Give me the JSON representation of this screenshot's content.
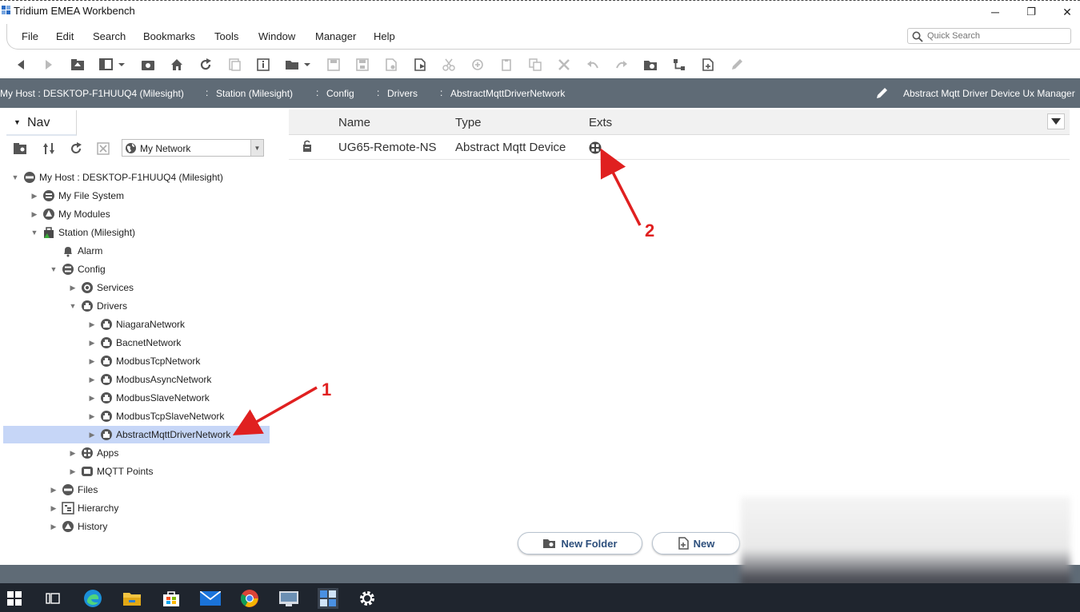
{
  "window": {
    "title": "Tridium EMEA Workbench",
    "minimize": "─",
    "restore": "❐",
    "close": "✕"
  },
  "menu": [
    "File",
    "Edit",
    "Search",
    "Bookmarks",
    "Tools",
    "Window",
    "Manager",
    "Help"
  ],
  "quick_search": {
    "placeholder": "Quick Search"
  },
  "toolbar": {
    "icons": [
      "back-icon",
      "forward-icon",
      "up-level-icon",
      "side-bar-icon",
      "refresh-icon",
      "home-icon",
      "reload-icon",
      "history-icon",
      "properties-icon",
      "open-icon",
      "save-icon",
      "save-all-icon",
      "save-bog-icon",
      "export-icon",
      "cut-icon",
      "copy-icon",
      "paste-icon",
      "duplicate-icon",
      "delete-icon",
      "undo-icon",
      "redo-icon",
      "new-folder-icon",
      "link-icon",
      "new-file-icon",
      "edit-icon"
    ]
  },
  "path": {
    "host": "My Host : DESKTOP-F1HUUQ4 (Milesight)",
    "station": "Station (Milesight)",
    "config": "Config",
    "drivers": "Drivers",
    "network": "AbstractMqttDriverNetwork",
    "separator": ":",
    "view": "Abstract Mqtt Driver Device Ux Manager"
  },
  "nav": {
    "tab_label": "Nav",
    "select_value": "My Network",
    "tree": [
      {
        "label": "My Host : DESKTOP-F1HUUQ4 (Milesight)",
        "icon": "host-icon",
        "state": "expanded"
      },
      {
        "label": "My File System",
        "icon": "file-system-icon",
        "state": "collapsed"
      },
      {
        "label": "My Modules",
        "icon": "modules-icon",
        "state": "collapsed"
      },
      {
        "label": "Station (Milesight)",
        "icon": "station-icon",
        "state": "expanded"
      },
      {
        "label": "Alarm",
        "icon": "alarm-icon",
        "state": "none"
      },
      {
        "label": "Config",
        "icon": "config-icon",
        "state": "expanded"
      },
      {
        "label": "Services",
        "icon": "services-icon",
        "state": "collapsed"
      },
      {
        "label": "Drivers",
        "icon": "drivers-icon",
        "state": "expanded"
      },
      {
        "label": "NiagaraNetwork",
        "icon": "network-icon",
        "state": "collapsed"
      },
      {
        "label": "BacnetNetwork",
        "icon": "network-icon",
        "state": "collapsed"
      },
      {
        "label": "ModbusTcpNetwork",
        "icon": "network-icon",
        "state": "collapsed"
      },
      {
        "label": "ModbusAsyncNetwork",
        "icon": "network-icon",
        "state": "collapsed"
      },
      {
        "label": "ModbusSlaveNetwork",
        "icon": "network-icon",
        "state": "collapsed"
      },
      {
        "label": "ModbusTcpSlaveNetwork",
        "icon": "network-icon",
        "state": "collapsed"
      },
      {
        "label": "AbstractMqttDriverNetwork",
        "icon": "network-icon",
        "state": "collapsed",
        "selected": true
      },
      {
        "label": "Apps",
        "icon": "apps-icon",
        "state": "collapsed"
      },
      {
        "label": "MQTT Points",
        "icon": "points-icon",
        "state": "collapsed"
      },
      {
        "label": "Files",
        "icon": "files-icon",
        "state": "collapsed"
      },
      {
        "label": "Hierarchy",
        "icon": "hierarchy-icon",
        "state": "collapsed"
      },
      {
        "label": "History",
        "icon": "history-icon",
        "state": "collapsed"
      }
    ]
  },
  "table": {
    "columns": [
      "Name",
      "Type",
      "Exts"
    ],
    "rows": [
      {
        "name": "UG65-Remote-NS",
        "type": "Abstract Mqtt Device",
        "exts_icon": "extensions-icon"
      }
    ]
  },
  "buttons": {
    "new_folder": "New Folder",
    "new": "New"
  },
  "annotations": {
    "arrow_1": "1",
    "arrow_2": "2",
    "color": "#e02020"
  },
  "taskbar": {
    "icons": [
      "windows-start-icon",
      "task-view-icon",
      "edge-icon",
      "file-explorer-icon",
      "store-icon",
      "mail-icon",
      "chrome-icon",
      "remote-desktop-icon",
      "workbench-icon",
      "settings-icon"
    ]
  },
  "colors": {
    "path_bar": "#5f6b76",
    "selected_row": "#c6d6f7",
    "button_text": "#2d4f7c",
    "taskbar": "#1f252e"
  }
}
